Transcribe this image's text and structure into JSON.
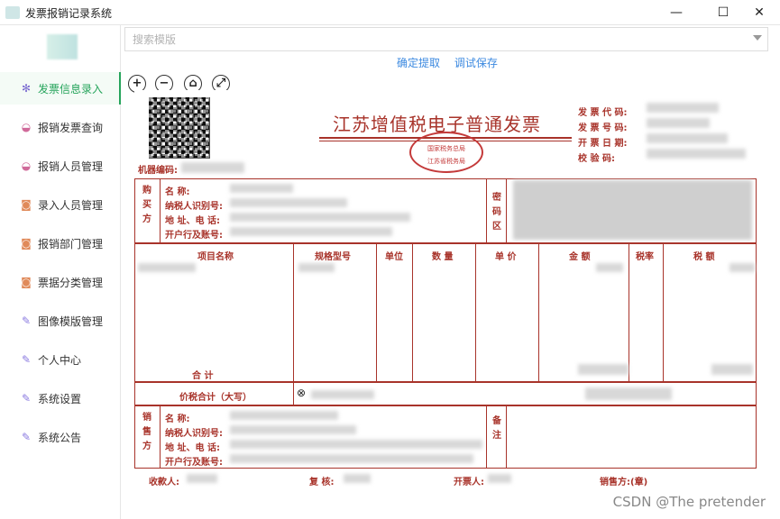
{
  "window": {
    "title": "发票报销记录系统",
    "minimize": "—",
    "maximize": "☐",
    "close": "✕"
  },
  "sidebar": {
    "items": [
      {
        "label": "发票信息录入",
        "icon": "pinwheel-icon",
        "active": true
      },
      {
        "label": "报销发票查询",
        "icon": "lipstick-icon"
      },
      {
        "label": "报销人员管理",
        "icon": "lipstick-icon"
      },
      {
        "label": "录入人员管理",
        "icon": "mirror-icon"
      },
      {
        "label": "报销部门管理",
        "icon": "mirror-icon"
      },
      {
        "label": "票据分类管理",
        "icon": "mirror-icon"
      },
      {
        "label": "图像模版管理",
        "icon": "brush-icon"
      },
      {
        "label": "个人中心",
        "icon": "brush-icon"
      },
      {
        "label": "系统设置",
        "icon": "brush-icon"
      },
      {
        "label": "系统公告",
        "icon": "brush-icon"
      }
    ]
  },
  "search": {
    "placeholder": "搜索模版"
  },
  "actions": {
    "confirm": "确定提取",
    "debug_save": "调试保存"
  },
  "toolbar": {
    "zoom_in": "+",
    "zoom_out": "−",
    "home": "⌂",
    "fit": "⤢"
  },
  "invoice": {
    "title": "江苏增值税电子普通发票",
    "stamp_top": "国家税务总局",
    "stamp_bottom": "江苏省税务局",
    "machine_no_label": "机器编码:",
    "header_labels": [
      "发 票 代 码:",
      "发 票 号 码:",
      "开 票 日 期:",
      "校  验  码:"
    ],
    "buyer_label": "购买方",
    "buyer_fields": [
      "名        称:",
      "纳税人识别号:",
      "地 址、电 话:",
      "开户行及账号:"
    ],
    "password_label": "密码区",
    "columns": [
      "项目名称",
      "规格型号",
      "单位",
      "数 量",
      "单 价",
      "金 额",
      "税率",
      "税 额"
    ],
    "subtotal_label": "合        计",
    "total_label": "价税合计（大写）",
    "total_symbol": "⊗",
    "seller_label": "销售方",
    "seller_fields": [
      "名        称:",
      "纳税人识别号:",
      "地 址、电 话:",
      "开户行及账号:"
    ],
    "remark_label": "备注",
    "footer": {
      "payee": "收款人:",
      "reviewer": "复    核:",
      "drawer": "开票人:",
      "seller_seal": "销售方:(章)"
    }
  },
  "watermark": "CSDN @The  pretender",
  "colors": {
    "accent": "#25a45b",
    "link": "#3d8ae0",
    "invoice_red": "#a8332a"
  }
}
